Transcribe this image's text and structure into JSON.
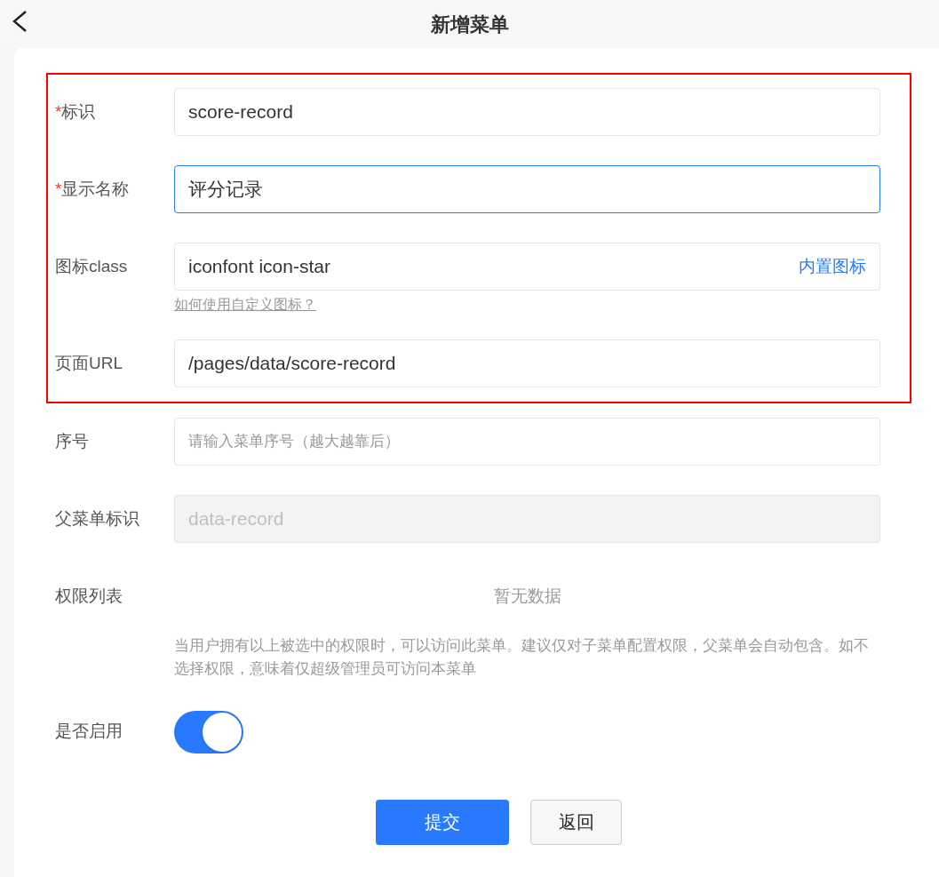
{
  "header": {
    "title": "新增菜单"
  },
  "required_mark": "*",
  "highlighted_fields": [
    {
      "label": "标识",
      "required": true,
      "value": "score-record",
      "focused": false,
      "disabled": false
    },
    {
      "label": "显示名称",
      "required": true,
      "value": "评分记录",
      "focused": true,
      "disabled": false
    },
    {
      "label": "图标class",
      "required": false,
      "value": "iconfont icon-star",
      "focused": false,
      "disabled": false,
      "suffix_link": "内置图标",
      "help_link": "如何使用自定义图标？"
    },
    {
      "label": "页面URL",
      "required": false,
      "value": "/pages/data/score-record",
      "focused": false,
      "disabled": false
    }
  ],
  "fields": [
    {
      "label": "序号",
      "required": false,
      "placeholder": "请输入菜单序号（越大越靠后）",
      "focused": false,
      "disabled": false
    },
    {
      "label": "父菜单标识",
      "required": false,
      "value": "data-record",
      "focused": false,
      "disabled": true
    }
  ],
  "permissions": {
    "label": "权限列表",
    "empty_text": "暂无数据",
    "hint": "当用户拥有以上被选中的权限时，可以访问此菜单。建议仅对子菜单配置权限，父菜单会自动包含。如不选择权限，意味着仅超级管理员可访问本菜单"
  },
  "enabled": {
    "label": "是否启用",
    "on": true
  },
  "buttons": [
    {
      "label": "提交",
      "kind": "primary"
    },
    {
      "label": "返回",
      "kind": "secondary"
    }
  ]
}
